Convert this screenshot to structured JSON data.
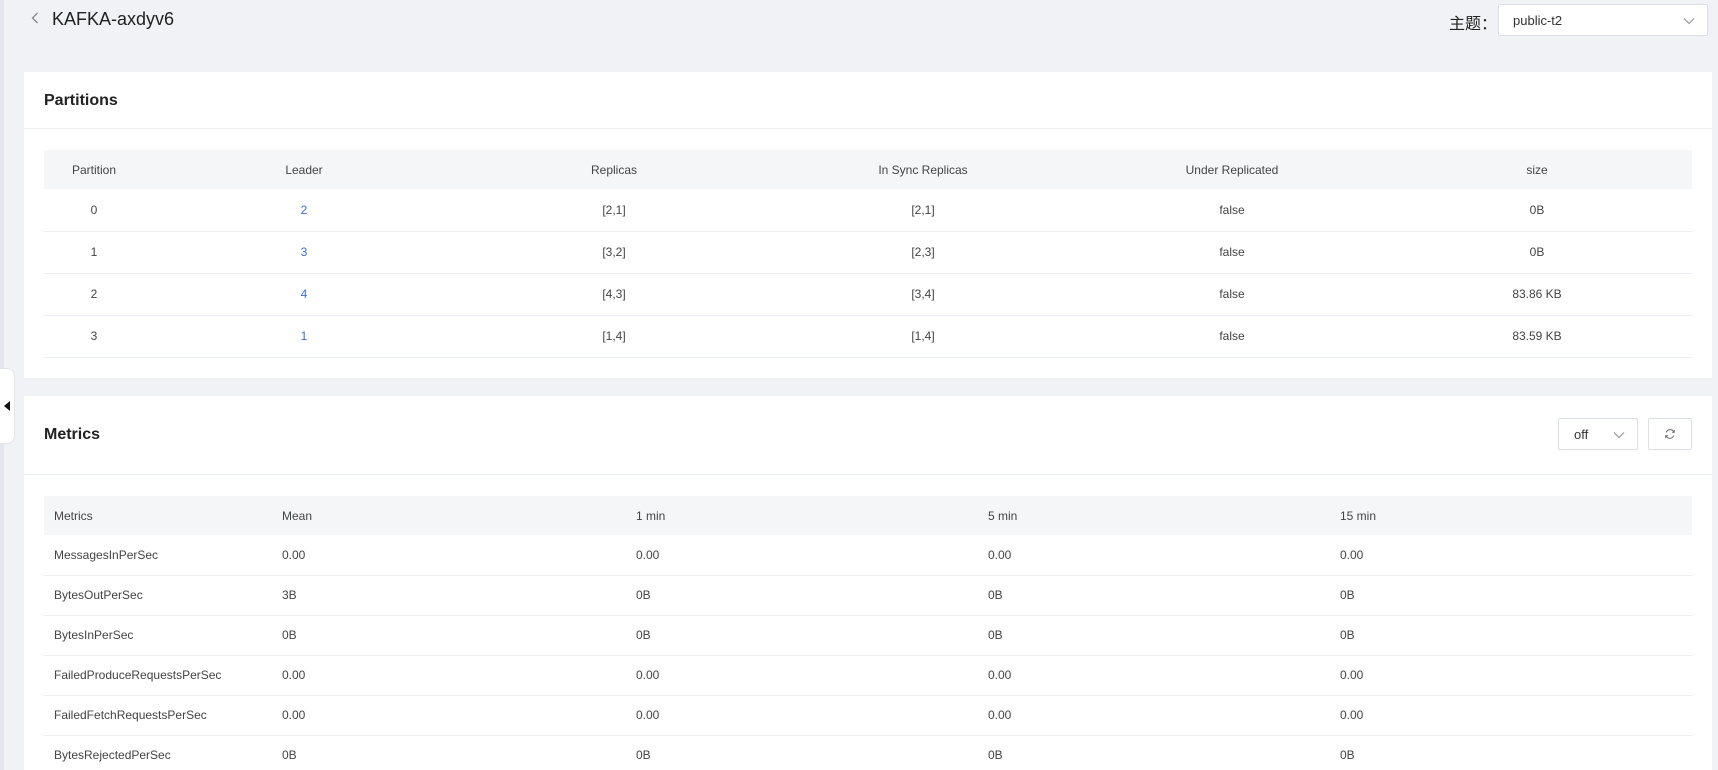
{
  "header": {
    "title": "KAFKA-axdyv6",
    "topic_label": "主题：",
    "topic_value": "public-t2"
  },
  "partitions": {
    "title": "Partitions",
    "columns": [
      "Partition",
      "Leader",
      "Replicas",
      "In Sync Replicas",
      "Under Replicated",
      "size"
    ],
    "rows": [
      {
        "partition": "0",
        "leader": "2",
        "replicas": "[2,1]",
        "isr": "[2,1]",
        "under_replicated": "false",
        "size": "0B"
      },
      {
        "partition": "1",
        "leader": "3",
        "replicas": "[3,2]",
        "isr": "[2,3]",
        "under_replicated": "false",
        "size": "0B"
      },
      {
        "partition": "2",
        "leader": "4",
        "replicas": "[4,3]",
        "isr": "[3,4]",
        "under_replicated": "false",
        "size": "83.86 KB"
      },
      {
        "partition": "3",
        "leader": "1",
        "replicas": "[1,4]",
        "isr": "[1,4]",
        "under_replicated": "false",
        "size": "83.59 KB"
      }
    ]
  },
  "metrics": {
    "title": "Metrics",
    "refresh_select": "off",
    "columns": [
      "Metrics",
      "Mean",
      "1 min",
      "5 min",
      "15 min"
    ],
    "rows": [
      {
        "name": "MessagesInPerSec",
        "mean": "0.00",
        "m1": "0.00",
        "m5": "0.00",
        "m15": "0.00"
      },
      {
        "name": "BytesOutPerSec",
        "mean": "3B",
        "m1": "0B",
        "m5": "0B",
        "m15": "0B"
      },
      {
        "name": "BytesInPerSec",
        "mean": "0B",
        "m1": "0B",
        "m5": "0B",
        "m15": "0B"
      },
      {
        "name": "FailedProduceRequestsPerSec",
        "mean": "0.00",
        "m1": "0.00",
        "m5": "0.00",
        "m15": "0.00"
      },
      {
        "name": "FailedFetchRequestsPerSec",
        "mean": "0.00",
        "m1": "0.00",
        "m5": "0.00",
        "m15": "0.00"
      },
      {
        "name": "BytesRejectedPerSec",
        "mean": "0B",
        "m1": "0B",
        "m5": "0B",
        "m15": "0B"
      }
    ]
  },
  "icons": {
    "back": "chevron-left-icon",
    "dropdown": "chevron-down-icon",
    "refresh": "refresh-icon",
    "collapse": "caret-left-icon"
  }
}
